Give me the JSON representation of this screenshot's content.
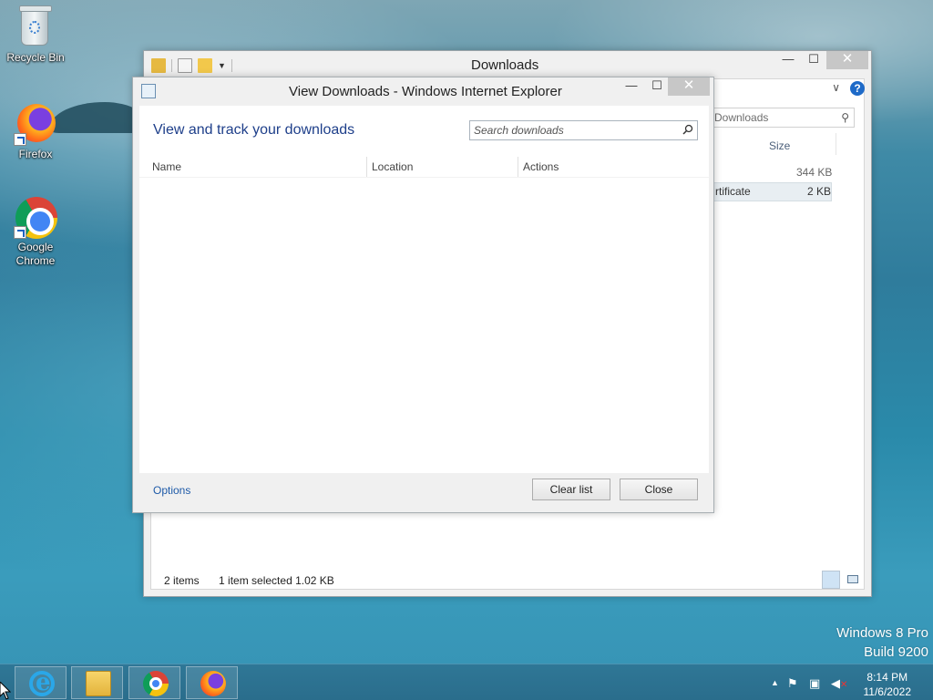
{
  "desktop": {
    "icons": [
      {
        "label": "Recycle Bin"
      },
      {
        "label": "Firefox"
      },
      {
        "label": "Google Chrome"
      }
    ],
    "watermark": {
      "line1": "Windows 8 Pro",
      "line2": "Build 9200"
    }
  },
  "explorer": {
    "title": "Downloads",
    "search_placeholder": "Downloads",
    "column_size": "Size",
    "rows": [
      {
        "name": "",
        "size": "344 KB"
      },
      {
        "name": "rtificate",
        "size": "2 KB"
      }
    ],
    "status": {
      "items": "2 items",
      "selected": "1 item selected  1.02 KB"
    }
  },
  "ie_dialog": {
    "title": "View Downloads - Windows Internet Explorer",
    "heading": "View and track your downloads",
    "search_placeholder": "Search downloads",
    "columns": [
      "Name",
      "Location",
      "Actions"
    ],
    "options_link": "Options",
    "clear_button": "Clear list",
    "close_button": "Close"
  },
  "taskbar": {
    "apps": [
      "internet-explorer-icon",
      "file-explorer-icon",
      "chrome-icon",
      "firefox-icon"
    ],
    "clock": {
      "time": "8:14 PM",
      "date": "11/6/2022"
    }
  }
}
